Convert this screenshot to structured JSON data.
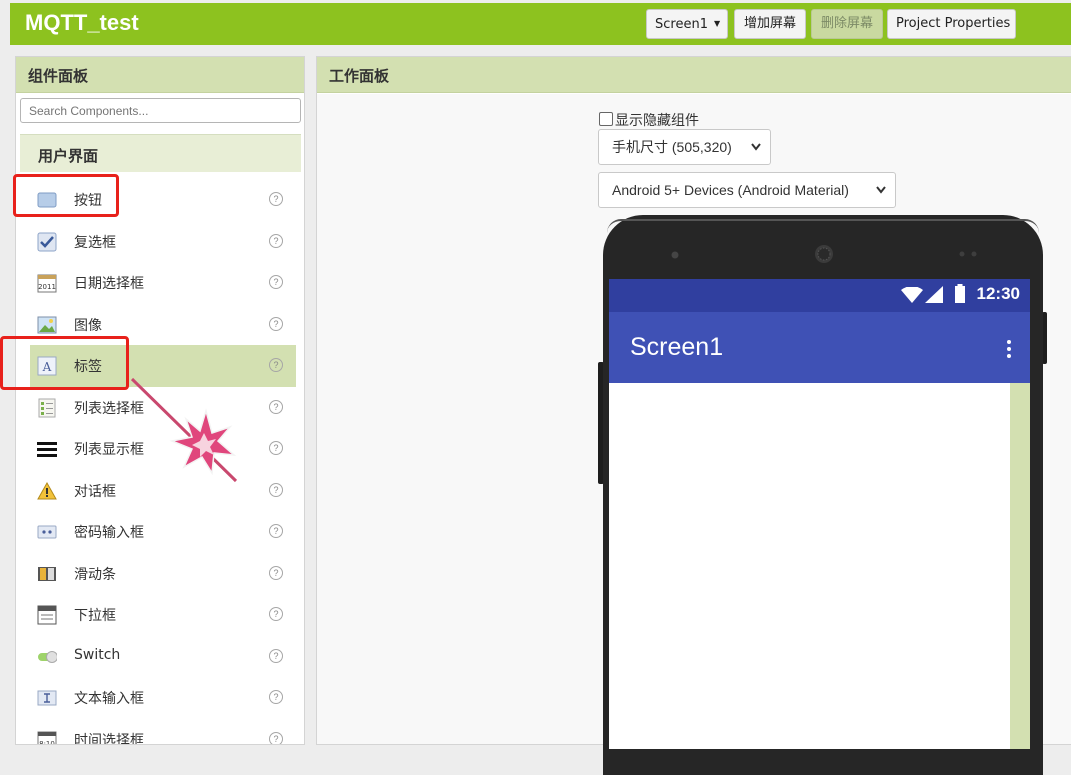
{
  "app": {
    "title": "MQTT_test"
  },
  "toolbar": {
    "screen_select": "Screen1",
    "add_screen": "增加屏幕",
    "remove_screen": "删除屏幕",
    "project_properties": "Project Properties"
  },
  "palette": {
    "title": "组件面板",
    "search_placeholder": "Search Components...",
    "section": "用户界面",
    "items": [
      {
        "label": "按钮",
        "icon": "button-icon"
      },
      {
        "label": "复选框",
        "icon": "checkbox-icon"
      },
      {
        "label": "日期选择框",
        "icon": "datepicker-icon"
      },
      {
        "label": "图像",
        "icon": "image-icon"
      },
      {
        "label": "标签",
        "icon": "label-icon",
        "selected": true
      },
      {
        "label": "列表选择框",
        "icon": "listpicker-icon"
      },
      {
        "label": "列表显示框",
        "icon": "listview-icon"
      },
      {
        "label": "对话框",
        "icon": "notifier-icon"
      },
      {
        "label": "密码输入框",
        "icon": "password-icon"
      },
      {
        "label": "滑动条",
        "icon": "slider-icon"
      },
      {
        "label": "下拉框",
        "icon": "spinner-icon"
      },
      {
        "label": "Switch",
        "icon": "switch-icon"
      },
      {
        "label": "文本输入框",
        "icon": "textbox-icon"
      },
      {
        "label": "时间选择框",
        "icon": "timepicker-icon"
      }
    ],
    "help_glyph": "?"
  },
  "viewer": {
    "title": "工作面板",
    "show_hidden_label": "显示隐藏组件",
    "size_select": "手机尺寸 (505,320)",
    "theme_select": "Android 5+ Devices (Android Material)"
  },
  "phone": {
    "clock": "12:30",
    "screen_title": "Screen1"
  },
  "colors": {
    "brand_green": "#8dc21f",
    "panel_header": "#d3e0b1",
    "status_bar": "#303f9f",
    "app_bar": "#3f51b5",
    "highlight_red": "#e8211b",
    "annotation_pink": "#d64a7a"
  }
}
